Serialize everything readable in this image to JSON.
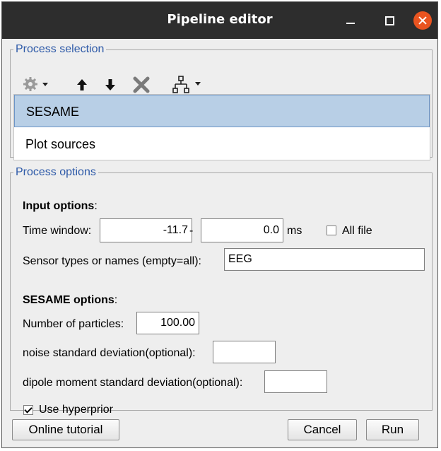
{
  "window": {
    "title": "Pipeline editor"
  },
  "process_selection": {
    "legend": "Process selection",
    "toolbar": [
      "gear-menu",
      "move-up",
      "move-down",
      "delete",
      "pipeline-menu"
    ],
    "items": [
      {
        "label": "SESAME",
        "selected": true
      },
      {
        "label": "Plot sources",
        "selected": false
      }
    ]
  },
  "process_options": {
    "legend": "Process options",
    "input_options": {
      "heading": "Input options",
      "colon": ":"
    },
    "time_window": {
      "label": "Time window:",
      "start": "-11.7",
      "dash": "-",
      "end": "0.0",
      "unit": "ms"
    },
    "all_file": {
      "label": "All file",
      "checked": false
    },
    "sensor": {
      "label": "Sensor types or names (empty=all):",
      "value": "EEG"
    },
    "sesame_options": {
      "heading": "SESAME options",
      "colon": ":"
    },
    "particles": {
      "label": "Number of particles:",
      "value": "100.00"
    },
    "noise_sd": {
      "label": "noise standard deviation(optional):",
      "value": ""
    },
    "dipole_sd": {
      "label": "dipole moment standard deviation(optional):",
      "value": ""
    },
    "hyperprior": {
      "label": "Use hyperprior",
      "checked": true
    }
  },
  "buttons": {
    "tutorial": "Online tutorial",
    "cancel": "Cancel",
    "run": "Run"
  },
  "colors": {
    "titlebar": "#2d2d2d",
    "close": "#e95420",
    "legend": "#2e5aa8",
    "selection": "#b8cfe6"
  }
}
